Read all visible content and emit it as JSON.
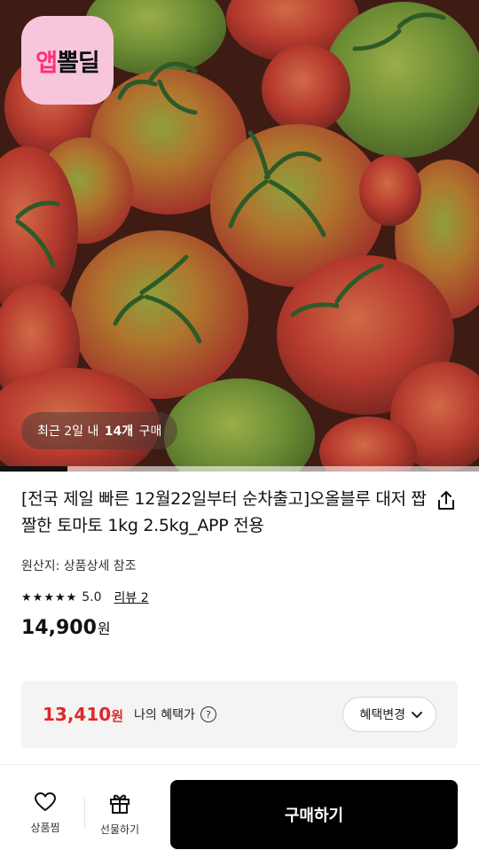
{
  "brand": {
    "logo_prefix": "앱",
    "logo_suffix": "뽈딜"
  },
  "hero": {
    "purchase_prefix": "최근 2일 내 ",
    "purchase_count": "14개",
    "purchase_suffix": " 구매",
    "gallery_progress": 0.14
  },
  "product": {
    "title": "[전국 제일 빠른 12월22일부터 순차출고]오올블루 대저 짭짤한 토마토 1kg 2.5kg_APP 전용",
    "origin": "원산지: 상품상세 참조",
    "rating": "5.0",
    "rating_stars": 5,
    "review_label": "리뷰 2",
    "price_value": "14,900",
    "price_unit": "원"
  },
  "benefit": {
    "price_value": "13,410",
    "price_unit": "원",
    "label": "나의 혜택가",
    "help_glyph": "?",
    "change_label": "혜택변경"
  },
  "bottom_bar": {
    "wishlist_label": "상품찜",
    "gift_label": "선물하기",
    "buy_label": "구매하기"
  },
  "colors": {
    "accent_red": "#e0282b",
    "logo_bg": "#f7c6dc",
    "logo_pink": "#ff2d78",
    "buy_bg": "#000000"
  },
  "icons": [
    "share-icon",
    "star-icon",
    "help-icon",
    "chevron-down-icon",
    "heart-icon",
    "gift-icon"
  ]
}
